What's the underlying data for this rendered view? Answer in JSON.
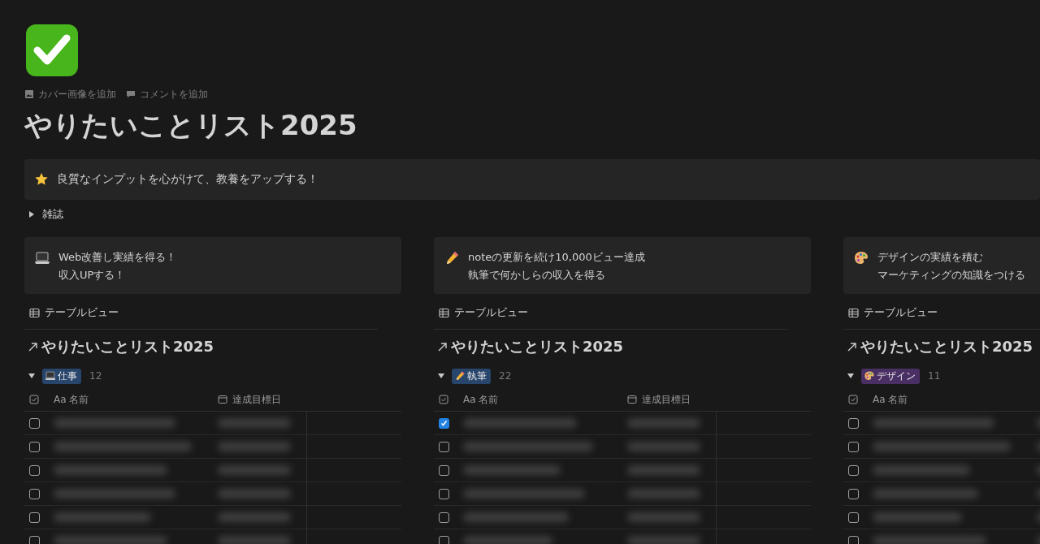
{
  "page": {
    "actions": [
      {
        "kind": "image",
        "label": "カバー画像を追加"
      },
      {
        "kind": "comment",
        "label": "コメントを追加"
      }
    ],
    "title": "やりたいことリスト2025",
    "callout": {
      "text": "良質なインプットを心がけて、教養をアップする！"
    },
    "toggle": {
      "label": "雑誌",
      "expanded": false
    }
  },
  "boards": [
    {
      "lines": [
        "Web改善し実績を得る！",
        "収入UPする！"
      ],
      "view": "テーブルビュー",
      "title": "やりたいことリスト2025",
      "group": {
        "label": "仕事",
        "color": "#28456c",
        "count": "12",
        "expanded": true
      },
      "name_header": "名前",
      "name_prefix": "Aa",
      "date_header": "達成目標日",
      "rows": [
        {
          "checked": false
        },
        {
          "checked": false
        },
        {
          "checked": false
        },
        {
          "checked": false
        },
        {
          "checked": false
        },
        {
          "checked": false
        }
      ]
    },
    {
      "lines": [
        "noteの更新を続け10,000ビュー達成",
        "執筆で何かしらの収入を得る"
      ],
      "view": "テーブルビュー",
      "title": "やりたいことリスト2025",
      "group": {
        "label": "執筆",
        "color": "#28456c",
        "count": "22",
        "expanded": true
      },
      "name_header": "名前",
      "name_prefix": "Aa",
      "date_header": "達成目標日",
      "rows": [
        {
          "checked": true
        },
        {
          "checked": false
        },
        {
          "checked": false
        },
        {
          "checked": false
        },
        {
          "checked": false
        },
        {
          "checked": false
        }
      ]
    },
    {
      "lines": [
        "デザインの実績を積む",
        "マーケティングの知識をつける"
      ],
      "view": "テーブルビュー",
      "title": "やりたいことリスト2025",
      "group": {
        "label": "デザイン",
        "color": "#492f64",
        "count": "11",
        "expanded": true
      },
      "name_header": "名前",
      "name_prefix": "Aa",
      "rows": [
        {
          "checked": false
        },
        {
          "checked": false
        },
        {
          "checked": false
        },
        {
          "checked": false
        },
        {
          "checked": false
        },
        {
          "checked": false
        }
      ]
    }
  ]
}
